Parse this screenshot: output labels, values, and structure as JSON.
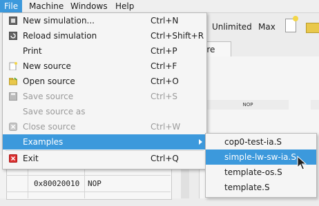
{
  "menubar": {
    "items": [
      {
        "label": "File"
      },
      {
        "label": "Machine"
      },
      {
        "label": "Windows"
      },
      {
        "label": "Help"
      }
    ]
  },
  "toolbar": {
    "unlimited_label": "Unlimited",
    "max_label": "Max"
  },
  "editor": {
    "tab_label": "ore",
    "nop_label": "NOP"
  },
  "memory_view": {
    "rows": [
      {
        "address": "0x80020010",
        "instruction": "NOP"
      }
    ]
  },
  "file_menu": {
    "items": [
      {
        "label": "New simulation...",
        "shortcut": "Ctrl+N",
        "icon": "new-simulation-icon",
        "enabled": true
      },
      {
        "label": "Reload simulation",
        "shortcut": "Ctrl+Shift+R",
        "icon": "reload-icon",
        "enabled": true
      },
      {
        "label": "Print",
        "shortcut": "Ctrl+P",
        "icon": "",
        "enabled": true
      },
      {
        "label": "New source",
        "shortcut": "Ctrl+F",
        "icon": "new-source-icon",
        "enabled": true
      },
      {
        "label": "Open source",
        "shortcut": "Ctrl+O",
        "icon": "open-folder-icon",
        "enabled": true
      },
      {
        "label": "Save source",
        "shortcut": "Ctrl+S",
        "icon": "save-icon",
        "enabled": false
      },
      {
        "label": "Save source as",
        "shortcut": "",
        "icon": "",
        "enabled": false
      },
      {
        "label": "Close source",
        "shortcut": "Ctrl+W",
        "icon": "close-icon",
        "enabled": false
      },
      {
        "label": "Examples",
        "shortcut": "",
        "icon": "",
        "enabled": true,
        "submenu": true,
        "highlighted": true
      },
      {
        "label": "Exit",
        "shortcut": "Ctrl+Q",
        "icon": "exit-icon",
        "enabled": true
      }
    ]
  },
  "examples_submenu": {
    "items": [
      {
        "label": "cop0-test-ia.S"
      },
      {
        "label": "simple-lw-sw-ia.S",
        "highlighted": true
      },
      {
        "label": "template-os.S"
      },
      {
        "label": "template.S"
      }
    ]
  },
  "colors": {
    "highlight": "#3c99dc",
    "menu_bg": "#f5f5f5",
    "disabled_text": "#9a9a9a"
  }
}
